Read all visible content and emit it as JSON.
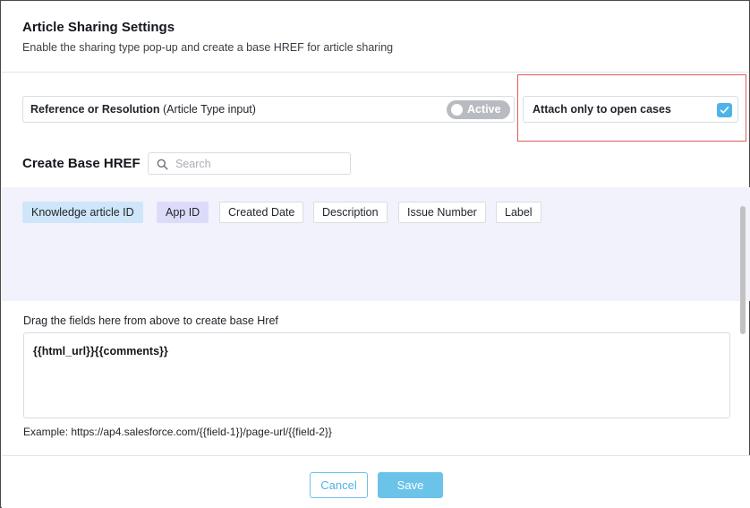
{
  "header": {
    "title": "Article Sharing Settings",
    "subtitle": "Enable the sharing type pop-up and create a base HREF for article sharing"
  },
  "reference": {
    "label_bold": "Reference or Resolution",
    "label_rest": " (Article Type input)",
    "toggle_label": "Active"
  },
  "attach": {
    "label": "Attach only to open cases",
    "checked": true
  },
  "base_href": {
    "section_title": "Create Base HREF",
    "search_placeholder": "Search",
    "search_value": "",
    "fields": [
      "Knowledge article ID",
      "App ID",
      "Created Date",
      "Description",
      "Issue Number",
      "Label"
    ],
    "drop_label": "Drag the fields here from above to create base Href",
    "href_value": "{{html_url}}{{comments}}",
    "example": "Example: https://ap4.salesforce.com/{{field-1}}/page-url/{{field-2}}"
  },
  "footer": {
    "cancel_label": "Cancel",
    "save_label": "Save"
  },
  "colors": {
    "accent": "#4fb3e8",
    "highlight_border": "#e25a5a",
    "fields_background": "#f2f2fc"
  }
}
